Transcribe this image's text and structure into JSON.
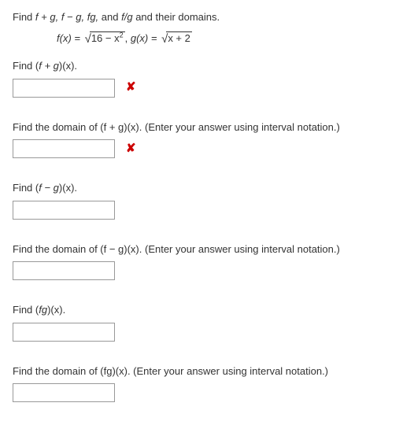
{
  "intro": {
    "text_pre": "Find ",
    "t1": "f + g,",
    "sep1": "  ",
    "t2": "f − g,",
    "sep2": "  ",
    "t3": "fg,",
    "and": "  and  ",
    "t4": "f/g",
    "text_post": "  and their domains."
  },
  "functions": {
    "f_label": "f(x) = ",
    "f_radicand_pre": "16 − x",
    "f_exp": "2",
    "comma": ",    ",
    "g_label": "g(x) = ",
    "g_radicand": "x + 2"
  },
  "q1": {
    "prompt_pre": "Find  (",
    "expr": "f + g",
    "prompt_post": ")(x).",
    "value": "",
    "wrong": "✘"
  },
  "q2": {
    "prompt": "Find the domain of  (f + g)(x).  (Enter your answer using interval notation.)",
    "value": "",
    "wrong": "✘"
  },
  "q3": {
    "prompt_pre": "Find  (",
    "expr": "f − g",
    "prompt_post": ")(x).",
    "value": ""
  },
  "q4": {
    "prompt": "Find the domain of  (f − g)(x).  (Enter your answer using interval notation.)",
    "value": ""
  },
  "q5": {
    "prompt_pre": "Find  (",
    "expr": "fg",
    "prompt_post": ")(x).",
    "value": ""
  },
  "q6": {
    "prompt": "Find the domain of  (fg)(x).  (Enter your answer using interval notation.)",
    "value": ""
  }
}
